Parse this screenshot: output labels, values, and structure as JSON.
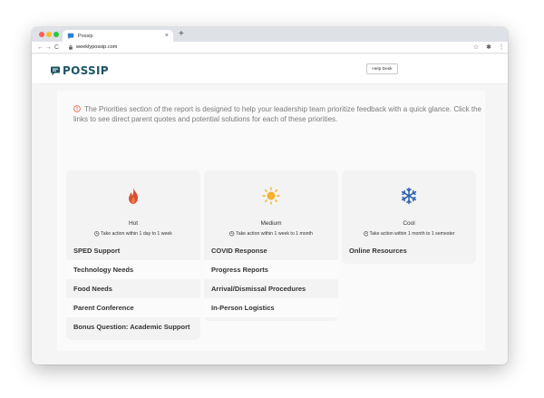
{
  "browser": {
    "tab_title": "Possip",
    "new_tab": "+",
    "close": "×",
    "url": "weeklypossip.com",
    "nav": {
      "back": "←",
      "forward": "→",
      "reload": "C"
    },
    "toolbar_icons": {
      "star": "☆",
      "extensions": "✱",
      "menu": "⋮"
    }
  },
  "header": {
    "logo_text": "POSSIP",
    "help_label": "Help Desk"
  },
  "intro_text": "The Priorities section of the report is designed to help your leadership team prioritize feedback with a quick glance. Click the links to see direct parent quotes and potential solutions for each of these priorities.",
  "columns": [
    {
      "title": "Hot",
      "subtitle": "Take action within 1 day to 1 week",
      "icon": "flame-icon",
      "items": [
        "SPED Support",
        "Technology Needs",
        "Food Needs",
        "Parent Conference",
        "Bonus Question: Academic Support"
      ]
    },
    {
      "title": "Medium",
      "subtitle": "Take action within 1 week to 1 month",
      "icon": "sun-icon",
      "items": [
        "COVID Response",
        "Progress Reports",
        "Arrival/Dismissal Procedures",
        "In-Person Logistics"
      ]
    },
    {
      "title": "Cool",
      "subtitle": "Take action within 1 month to 1 semester",
      "icon": "snowflake-icon",
      "items": [
        "Online Resources"
      ]
    }
  ],
  "colors": {
    "brand": "#1e5466",
    "hot": "#d9502f",
    "medium": "#f5b22a",
    "cool": "#2b62b0",
    "info": "#e2553a"
  }
}
